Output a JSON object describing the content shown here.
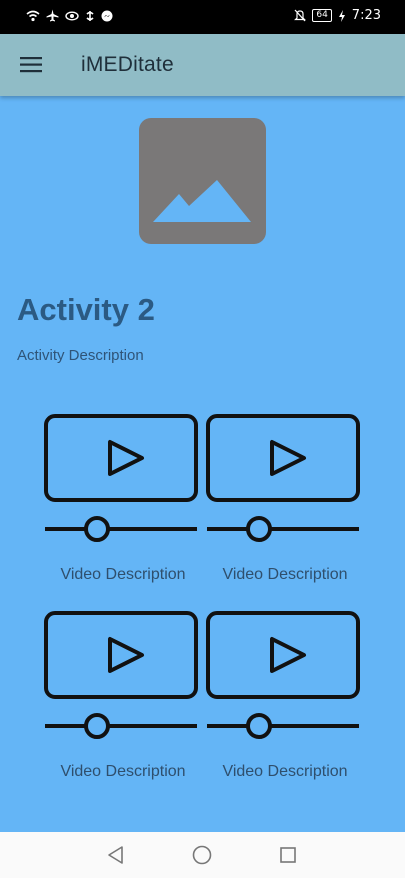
{
  "status_bar": {
    "time": "7:23",
    "battery": "64"
  },
  "app_bar": {
    "title": "iMEDitate"
  },
  "activity": {
    "title": "Activity 2",
    "description": "Activity Description"
  },
  "videos": [
    {
      "description": "Video Description"
    },
    {
      "description": "Video Description"
    },
    {
      "description": "Video Description"
    },
    {
      "description": "Video Description"
    }
  ],
  "colors": {
    "background": "#64b5f6",
    "app_bar": "#90bcc6",
    "title_text": "#2b5a83",
    "image_placeholder": "#7a7878"
  },
  "icons": [
    "wifi-icon",
    "airplane-icon",
    "eye-icon",
    "data-icon",
    "messenger-icon",
    "mute-icon",
    "battery-icon",
    "charging-icon",
    "menu-icon",
    "image-placeholder-icon",
    "video-player-icon",
    "back-icon",
    "home-icon",
    "recents-icon"
  ]
}
